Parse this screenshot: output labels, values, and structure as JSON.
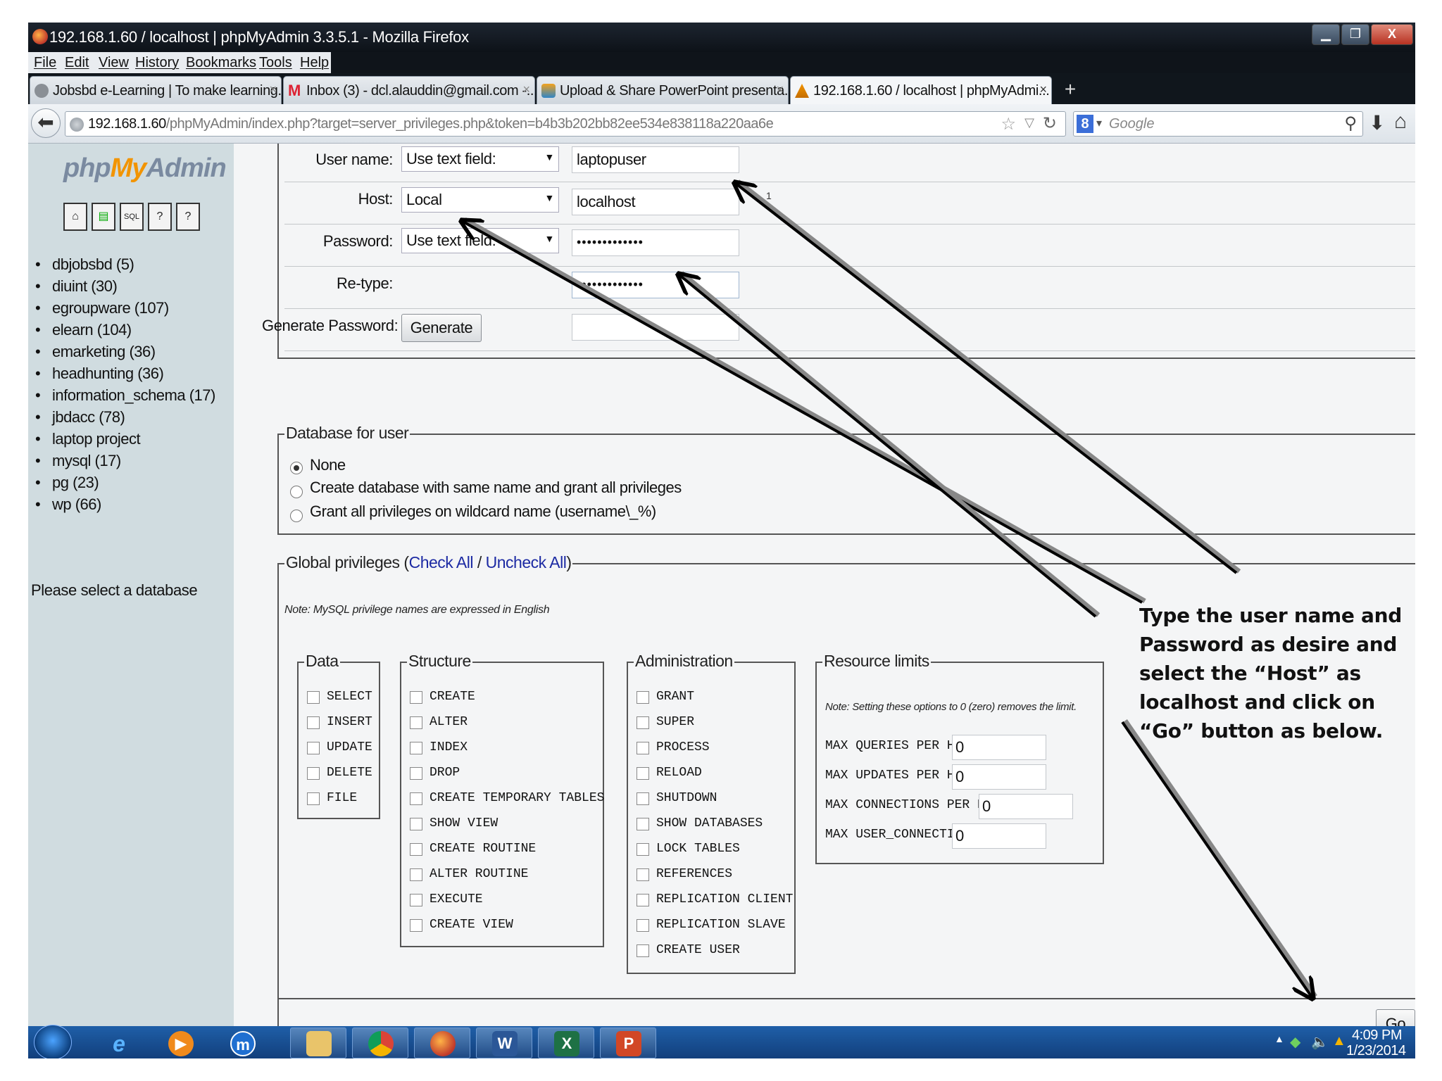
{
  "window": {
    "title": "192.168.1.60 / localhost | phpMyAdmin 3.3.5.1 - Mozilla Firefox",
    "min_glyph": "▁",
    "max_glyph": "❐",
    "close_glyph": "X"
  },
  "menu": [
    "File",
    "Edit",
    "View",
    "History",
    "Bookmarks",
    "Tools",
    "Help"
  ],
  "tabs": [
    {
      "label": "Jobsbd e-Learning | To make learning...",
      "close": "×"
    },
    {
      "label": "Inbox (3) - dcl.alauddin@gmail.com -...",
      "close": "×"
    },
    {
      "label": "Upload & Share PowerPoint presenta...",
      "close": "×"
    },
    {
      "label": "192.168.1.60 / localhost | phpMyAdmi...",
      "close": "×"
    }
  ],
  "new_tab": "+",
  "nav": {
    "back": "⬅",
    "url_host": "192.168.1.60",
    "url_path": "/phpMyAdmin/index.php?target=server_privileges.php&token=b4b3b202bb82ee534e838118a220aa6e",
    "search_placeholder": "Google",
    "search_engine_glyph": "8"
  },
  "sidebar": {
    "logo_php": "php",
    "logo_my": "My",
    "logo_admin": "Admin",
    "databases": [
      "dbjobsbd (5)",
      "diuint (30)",
      "egroupware (107)",
      "elearn (104)",
      "emarketing (36)",
      "headhunting (36)",
      "information_schema (17)",
      "jbdacc (78)",
      "laptop project",
      "mysql (17)",
      "pg (23)",
      "wp (66)"
    ],
    "message": "Please select a database"
  },
  "login": {
    "username_label": "User name:",
    "username_mode": "Use text field:",
    "username_value": "laptopuser",
    "host_label": "Host:",
    "host_mode": "Local",
    "host_value": "localhost",
    "host_footnote": "1",
    "password_label": "Password:",
    "password_mode": "Use text field:",
    "password_value": "•••••••••••••",
    "retype_label": "Re-type:",
    "retype_value": "•••••••••••••",
    "generate_label": "Generate Password:",
    "generate_button": "Generate",
    "generate_value": ""
  },
  "database_for_user": {
    "legend": "Database for user",
    "options": [
      "None",
      "Create database with same name and grant all privileges",
      "Grant all privileges on wildcard name (username\\_%)"
    ],
    "selected": 0
  },
  "global_privileges": {
    "legend_prefix": "Global privileges (",
    "check_all": "Check All",
    "separator": " / ",
    "uncheck_all": "Uncheck All",
    "legend_suffix": ")",
    "note": "Note: MySQL privilege names are expressed in English",
    "data": {
      "legend": "Data",
      "items": [
        "SELECT",
        "INSERT",
        "UPDATE",
        "DELETE",
        "FILE"
      ]
    },
    "structure": {
      "legend": "Structure",
      "items": [
        "CREATE",
        "ALTER",
        "INDEX",
        "DROP",
        "CREATE TEMPORARY TABLES",
        "SHOW VIEW",
        "CREATE ROUTINE",
        "ALTER ROUTINE",
        "EXECUTE",
        "CREATE VIEW"
      ]
    },
    "administration": {
      "legend": "Administration",
      "items": [
        "GRANT",
        "SUPER",
        "PROCESS",
        "RELOAD",
        "SHUTDOWN",
        "SHOW DATABASES",
        "LOCK TABLES",
        "REFERENCES",
        "REPLICATION CLIENT",
        "REPLICATION SLAVE",
        "CREATE USER"
      ]
    },
    "resource_limits": {
      "legend": "Resource limits",
      "note": "Note: Setting these options to 0 (zero) removes the limit.",
      "items": [
        {
          "label": "MAX QUERIES PER HOUR",
          "value": "0"
        },
        {
          "label": "MAX UPDATES PER HOUR",
          "value": "0"
        },
        {
          "label": "MAX CONNECTIONS PER HOUR",
          "value": "0"
        },
        {
          "label": "MAX USER_CONNECTIONS",
          "value": "0"
        }
      ]
    }
  },
  "go_button": "Go",
  "annotation": "Type the user name and Password as desire and select the “Host” as localhost and click on “Go” button as below.",
  "taskbar": {
    "time": "4:09 PM",
    "date": "1/23/2014",
    "tray_up": "▲"
  }
}
